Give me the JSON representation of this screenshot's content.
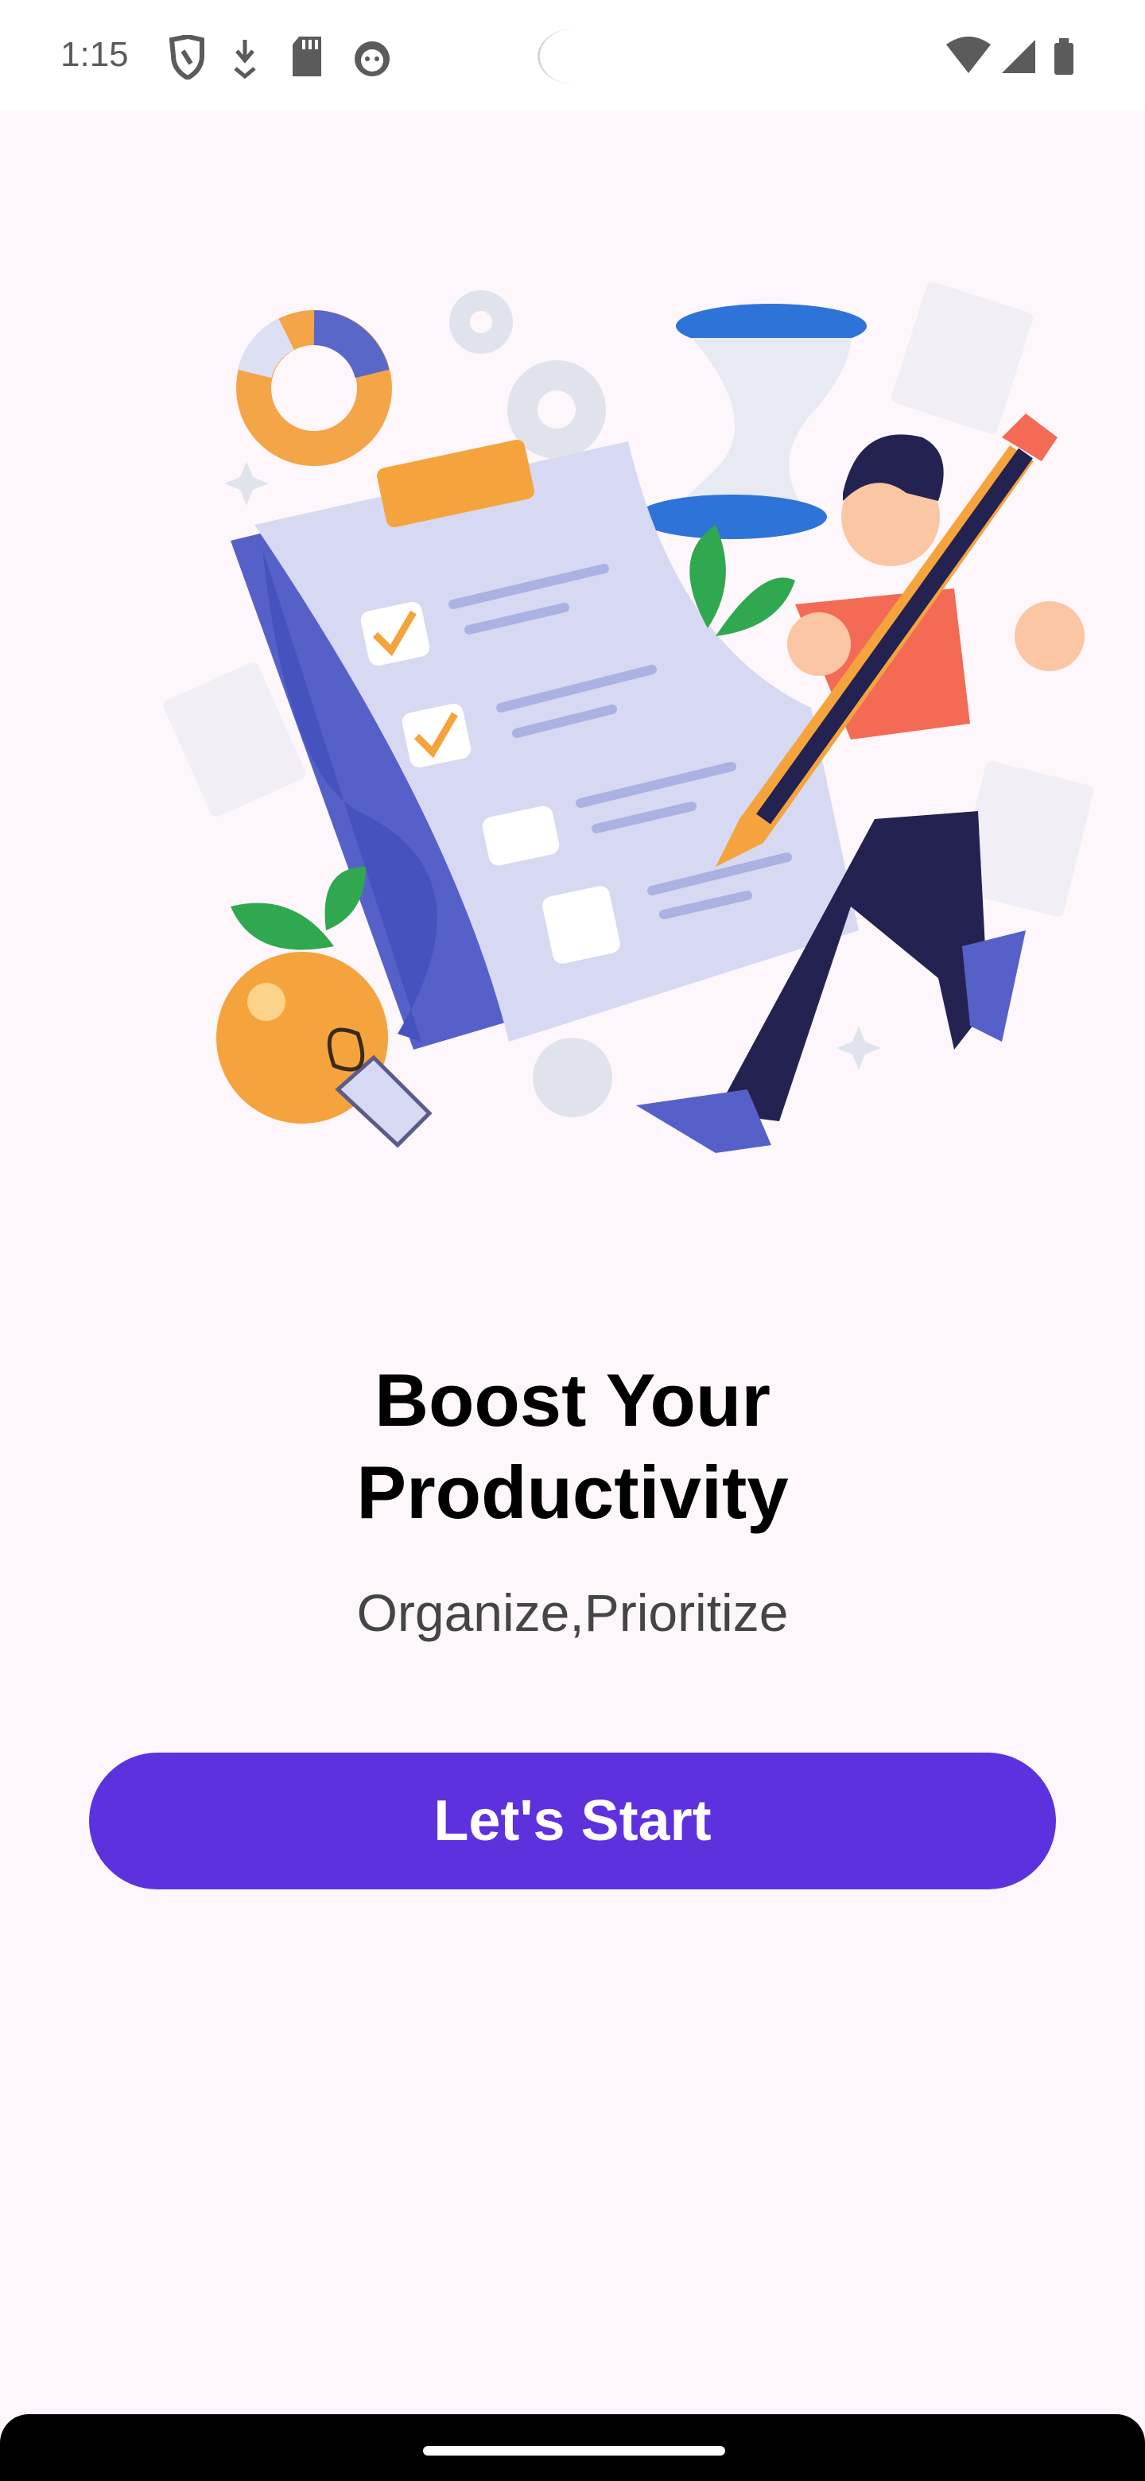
{
  "status_bar": {
    "time": "1:15",
    "left_icons": [
      "shield-icon",
      "download-icon",
      "sd-card-icon",
      "cat-icon"
    ],
    "right_icons": [
      "wifi-icon",
      "signal-icon",
      "battery-icon"
    ]
  },
  "onboarding": {
    "illustration": "productivity-checklist-illustration",
    "title_line1": "Boost Your",
    "title_line2": "Productivity",
    "subtitle": "Organize,Prioritize",
    "start_label": "Let's Start"
  },
  "colors": {
    "background": "#fdf7fb",
    "accent": "#5e31df",
    "button_text": "#ffffff"
  }
}
